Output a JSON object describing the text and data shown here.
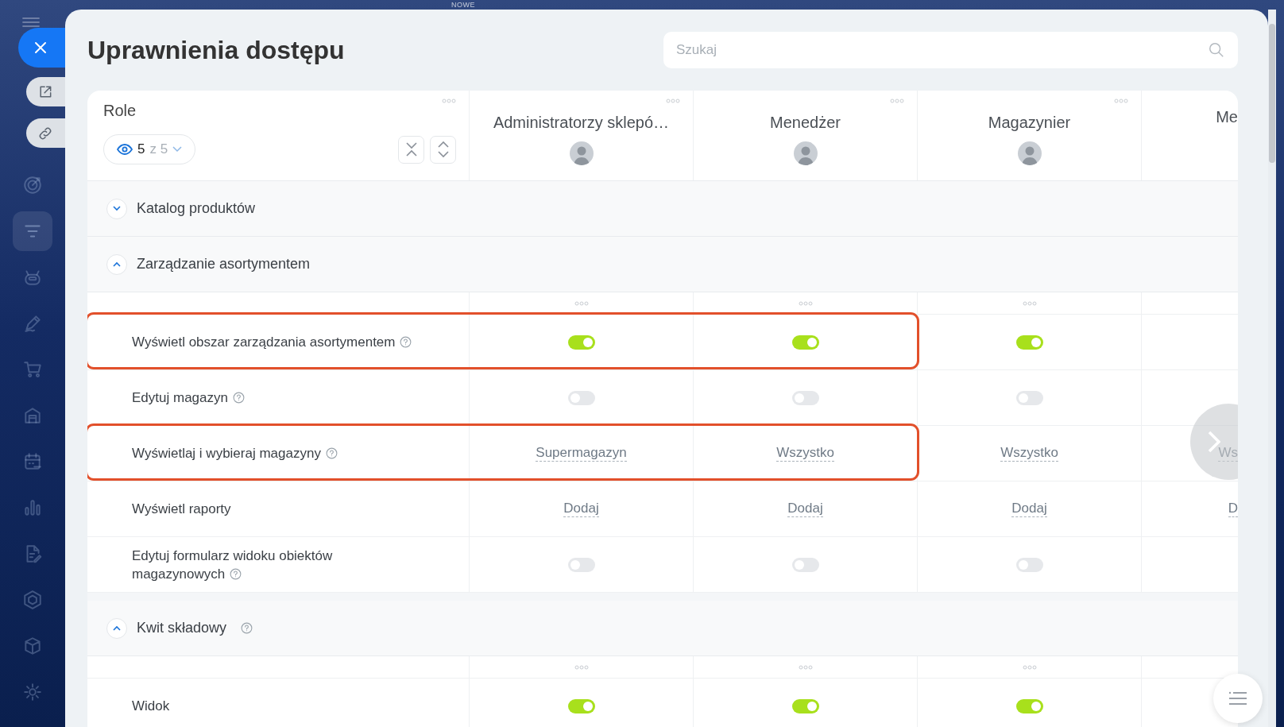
{
  "background_label": "NOWE",
  "sidebar": {
    "items": [
      {
        "kind": "target",
        "selected": false
      },
      {
        "kind": "filter",
        "selected": true
      },
      {
        "kind": "robot",
        "selected": false
      },
      {
        "kind": "pencil",
        "selected": false
      },
      {
        "kind": "cart",
        "selected": false
      },
      {
        "kind": "warehouse",
        "selected": false
      },
      {
        "kind": "calendar",
        "selected": false
      },
      {
        "kind": "chart",
        "selected": false
      },
      {
        "kind": "document",
        "selected": false
      },
      {
        "kind": "hexagon",
        "selected": false
      },
      {
        "kind": "box",
        "selected": false
      },
      {
        "kind": "gear",
        "selected": false
      }
    ]
  },
  "panel": {
    "title": "Uprawnienia dostępu",
    "search": {
      "placeholder": "Szukaj"
    }
  },
  "table": {
    "role_header": {
      "label": "Role",
      "shown": "5",
      "of_total": "z 5"
    },
    "columns": [
      {
        "label": "Administratorzy sklepó…",
        "avatar": true
      },
      {
        "label": "Menedżer",
        "avatar": true
      },
      {
        "label": "Magazynier",
        "avatar": true
      },
      {
        "label": "Me",
        "avatar": false
      }
    ],
    "sections": [
      {
        "title": "Katalog produktów",
        "expanded": false,
        "help": false
      },
      {
        "title": "Zarządzanie asortymentem",
        "expanded": true,
        "help": false,
        "rows": [
          {
            "label": "Wyświetl obszar zarządzania asortymentem",
            "help": true,
            "highlighted": true,
            "cells": [
              {
                "kind": "toggle",
                "on": true
              },
              {
                "kind": "toggle",
                "on": true
              },
              {
                "kind": "toggle",
                "on": true
              }
            ]
          },
          {
            "label": "Edytuj magazyn",
            "help": true,
            "highlighted": false,
            "cells": [
              {
                "kind": "toggle",
                "on": false
              },
              {
                "kind": "toggle",
                "on": false
              },
              {
                "kind": "toggle",
                "on": false
              }
            ]
          },
          {
            "label": "Wyświetlaj i wybieraj magazyny",
            "help": true,
            "highlighted": true,
            "cells": [
              {
                "kind": "link",
                "text": "Supermagazyn"
              },
              {
                "kind": "link",
                "text": "Wszystko"
              },
              {
                "kind": "link",
                "text": "Wszystko"
              },
              {
                "kind": "link",
                "text": "Ws"
              }
            ]
          },
          {
            "label": "Wyświetl raporty",
            "help": false,
            "highlighted": false,
            "cells": [
              {
                "kind": "link",
                "text": "Dodaj"
              },
              {
                "kind": "link",
                "text": "Dodaj"
              },
              {
                "kind": "link",
                "text": "Dodaj"
              },
              {
                "kind": "link",
                "text": "D"
              }
            ]
          },
          {
            "label": "Edytuj formularz widoku obiektów magazynowych",
            "help": true,
            "highlighted": false,
            "cells": [
              {
                "kind": "toggle",
                "on": false
              },
              {
                "kind": "toggle",
                "on": false
              },
              {
                "kind": "toggle",
                "on": false
              }
            ]
          }
        ]
      },
      {
        "title": "Kwit składowy",
        "expanded": true,
        "help": true,
        "rows": [
          {
            "label": "Widok",
            "help": false,
            "highlighted": false,
            "cells": [
              {
                "kind": "toggle",
                "on": true
              },
              {
                "kind": "toggle",
                "on": true
              },
              {
                "kind": "toggle",
                "on": true
              }
            ]
          }
        ]
      }
    ]
  }
}
